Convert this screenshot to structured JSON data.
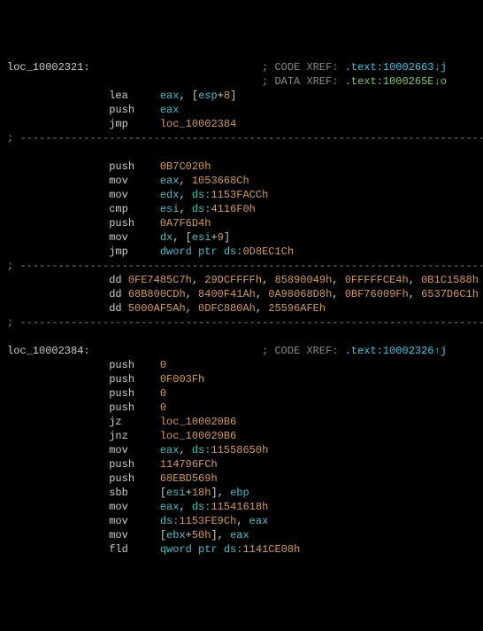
{
  "block1": {
    "label": "loc_10002321",
    "xref1_prefix": "; CODE XREF: ",
    "xref1_link": ".text:10002663↓j",
    "xref2_prefix": "; DATA XREF: ",
    "xref2_link": ".text:1000265E↓o",
    "l1_mnem": "lea",
    "l1_r1": "eax",
    "l1_c": ", [",
    "l1_r2": "esp",
    "l1_p": "+",
    "l1_n": "8",
    "l1_close": "]",
    "l2_mnem": "push",
    "l2_r": "eax",
    "l3_mnem": "jmp",
    "l3_t": "loc_10002384"
  },
  "sep": "; ---------------------------------------------------------------------------",
  "block2": {
    "l1_mnem": "push",
    "l1_n": "0B7C020h",
    "l2_mnem": "mov",
    "l2_r": "eax",
    "l2_n": "1053668Ch",
    "l3_mnem": "mov",
    "l3_r": "edx",
    "l3_p": "ds:",
    "l3_n": "1153FACCh",
    "l4_mnem": "cmp",
    "l4_r": "esi",
    "l4_p": "ds:",
    "l4_n": "4116F0h",
    "l5_mnem": "push",
    "l5_n": "0A7F6D4h",
    "l6_mnem": "mov",
    "l6_r": "dx",
    "l6_b": "[",
    "l6_r2": "esi",
    "l6_p": "+",
    "l6_n": "9",
    "l6_c": "]",
    "l7_mnem": "jmp",
    "l7_p": "dword ptr ds:",
    "l7_n": "0D8EC1Ch"
  },
  "data": {
    "dd": "dd",
    "l1v1": "0FE7485C7h",
    "l1v2": "29DCFFFFh",
    "l1v3": "85890049h",
    "l1v4": "0FFFFFCE4h",
    "l1v5": "0B1C1588h",
    "l2v1": "68B800CDh",
    "l2v2": "8400F41Ah",
    "l2v3": "0A98068D8h",
    "l2v4": "0BF76009Fh",
    "l2v5": "6537D6C1h",
    "l3v1": "5000AF5Ah",
    "l3v2": "0DFC880Ah",
    "l3v3": "25596AFEh"
  },
  "block3": {
    "label": "loc_10002384",
    "xref_prefix": "; CODE XREF: ",
    "xref_link": ".text:10002326↑j",
    "l1_mnem": "push",
    "l1_n": "0",
    "l2_mnem": "push",
    "l2_n": "0F003Fh",
    "l3_mnem": "push",
    "l3_n": "0",
    "l4_mnem": "push",
    "l4_n": "0",
    "l5_mnem": "jz",
    "l5_t": "loc_100020B6",
    "l6_mnem": "jnz",
    "l6_t": "loc_100020B6",
    "l7_mnem": "mov",
    "l7_r": "eax",
    "l7_p": "ds:",
    "l7_n": "11558650h",
    "l8_mnem": "push",
    "l8_n": "114796FCh",
    "l9_mnem": "push",
    "l9_n": "68EBD569h",
    "l10_mnem": "sbb",
    "l10_b": "[",
    "l10_r": "esi",
    "l10_p": "+",
    "l10_n": "18h",
    "l10_c": "], ",
    "l10_r2": "ebp",
    "l11_mnem": "mov",
    "l11_r": "eax",
    "l11_p": "ds:",
    "l11_n": "11541618h",
    "l12_mnem": "mov",
    "l12_p": "ds:",
    "l12_n": "1153FE9Ch",
    "l12_c": ", ",
    "l12_r": "eax",
    "l13_mnem": "mov",
    "l13_b": "[",
    "l13_r": "ebx",
    "l13_p": "+",
    "l13_n": "50h",
    "l13_c": "], ",
    "l13_r2": "eax",
    "l14_mnem": "fld",
    "l14_p": "qword ptr ds:",
    "l14_n": "1141CE08h"
  }
}
